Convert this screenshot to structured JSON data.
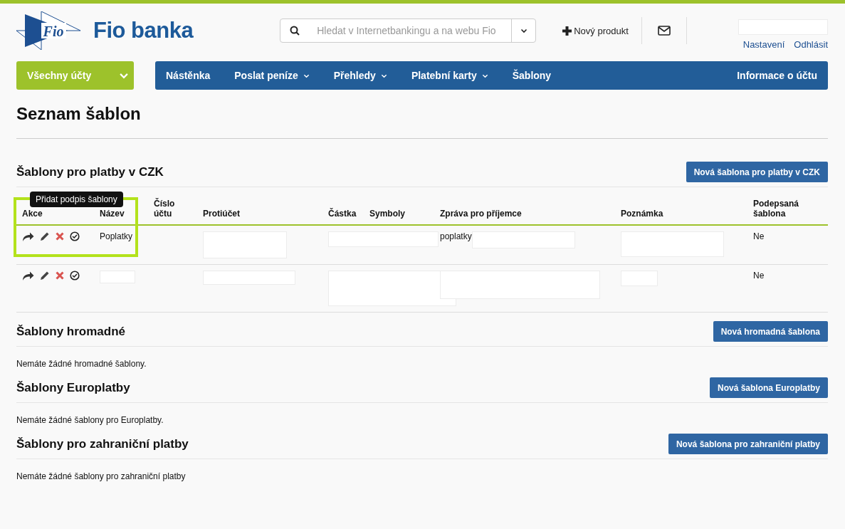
{
  "header": {
    "logo_mark": "Fio",
    "logo_text": "Fio banka",
    "search": {
      "placeholder": "Hledat v Internetbankingu a na webu Fio"
    },
    "new_product": "Nový produkt",
    "user_links": [
      "Nastavení",
      "Odhlásit"
    ]
  },
  "account_select": {
    "label": "Všechny účty"
  },
  "nav": {
    "items": [
      {
        "label": "Nástěnka",
        "dropdown": false
      },
      {
        "label": "Poslat peníze",
        "dropdown": true
      },
      {
        "label": "Přehledy",
        "dropdown": true
      },
      {
        "label": "Platební karty",
        "dropdown": true
      },
      {
        "label": "Šablony",
        "dropdown": false
      }
    ],
    "right": "Informace o účtu"
  },
  "page_title": "Seznam šablon",
  "sections": [
    {
      "kind": "table",
      "title": "Šablony pro platby v CZK",
      "button": "Nová šablona pro platby v CZK",
      "table": {
        "columns": [
          "Akce",
          "Název",
          "Číslo účtu",
          "Protiúčet",
          "Částka",
          "Symboly",
          "Zpráva pro příjemce",
          "Poznámka",
          "Podepsaná šablona"
        ],
        "rows": [
          {
            "name": "Poplatky",
            "message": "poplatky",
            "signed": "Ne",
            "highlighted": true,
            "tooltip": "Přidat podpis šablony"
          },
          {
            "signed": "Ne",
            "highlighted": false
          }
        ]
      }
    },
    {
      "kind": "empty",
      "title": "Šablony hromadné",
      "button": "Nová hromadná šablona",
      "message": "Nemáte žádné hromadné šablony."
    },
    {
      "kind": "empty",
      "title": "Šablony Europlatby",
      "button": "Nová šablona Europlatby",
      "message": "Nemáte žádné šablony pro Europlatby."
    },
    {
      "kind": "empty",
      "title": "Šablony pro zahraniční platby",
      "button": "Nová šablona pro zahraniční platby",
      "message": "Nemáte žádné šablony pro zahraniční platby"
    }
  ]
}
